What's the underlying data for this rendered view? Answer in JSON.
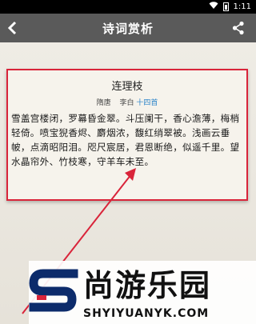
{
  "status_bar": {
    "time": "1:11"
  },
  "app_bar": {
    "title": "诗词赏析"
  },
  "poem": {
    "title": "连理枝",
    "dynasty": "隋唐",
    "author": "李白",
    "count_label": "十四首",
    "body": "雪盖宫楼闭，罗幕昏金翠。斗压阑干，香心澹薄，梅梢轻倚。喷宝猊香烬、麝烟浓，馥红绡翠被。浅画云垂帔，点滴昭阳泪。咫尺宸居，君恩断绝，似遥千里。望水晶帘外、竹枝寒，守羊车未至。"
  },
  "watermark": {
    "brand": "尚游乐园",
    "domain": "SHYIYUANYK.COM",
    "colors": {
      "accent": "#d9243a",
      "navy": "#0c2b6b"
    }
  },
  "colors": {
    "highlight_border": "#d9243a",
    "link": "#2a83c9",
    "app_bar": "#5a5a5a"
  }
}
